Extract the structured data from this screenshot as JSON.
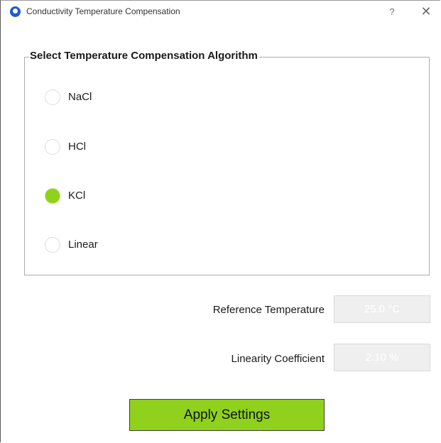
{
  "window": {
    "title": "Conductivity Temperature Compensation",
    "help_glyph": "?",
    "close_glyph": "✕"
  },
  "algorithm_group": {
    "title": "Select Temperature Compensation Algorithm",
    "options": [
      {
        "label": "NaCl",
        "checked": false
      },
      {
        "label": "HCl",
        "checked": false
      },
      {
        "label": "KCl",
        "checked": true
      },
      {
        "label": "Linear",
        "checked": false
      }
    ]
  },
  "fields": {
    "reference_temperature": {
      "label": "Reference Temperature",
      "value": "25.0 °C"
    },
    "linearity_coefficient": {
      "label": "Linearity Coefficient",
      "value": "2.10 %"
    }
  },
  "actions": {
    "apply_label": "Apply Settings"
  },
  "colors": {
    "accent_green": "#8fd11c",
    "app_icon_blue": "#1e5cc8"
  },
  "icons": {
    "app": "app-icon",
    "help": "help-icon",
    "close": "close-icon"
  }
}
